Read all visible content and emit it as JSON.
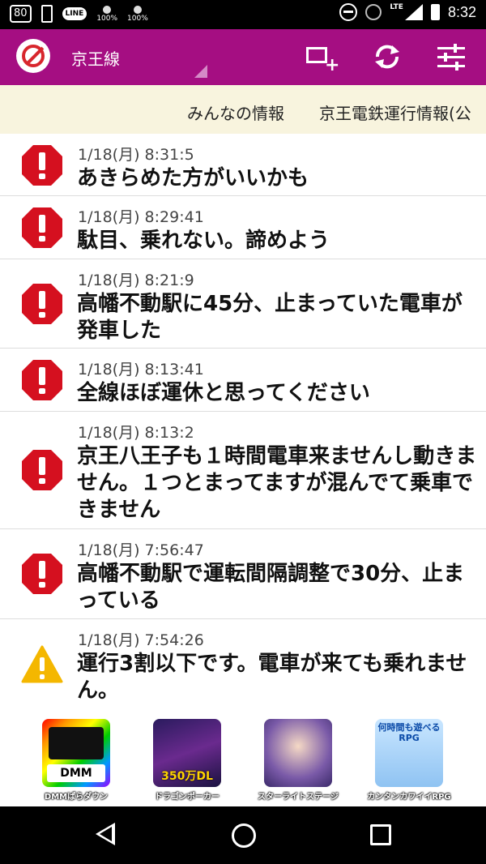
{
  "status_bar": {
    "notif_box": "80",
    "line_label": "LINE",
    "battery1": "100%",
    "battery2": "100%",
    "network": "LTE",
    "time": "8:32"
  },
  "app_bar": {
    "line_name": "京王線",
    "bg_color": "#a50e82"
  },
  "ticker": {
    "items": [
      "みんなの情報",
      "京王電鉄運行情報(公"
    ]
  },
  "posts": [
    {
      "time": "1/18(月) 8:31:5",
      "message": "あきらめた方がいいかも",
      "severity": "error"
    },
    {
      "time": "1/18(月) 8:29:41",
      "message": "駄目、乗れない。諦めよう",
      "severity": "error"
    },
    {
      "time": "1/18(月) 8:21:9",
      "message": "高幡不動駅に45分、止まっていた電車が発車した",
      "severity": "error"
    },
    {
      "time": "1/18(月) 8:13:41",
      "message": "全線ほぼ運休と思ってください",
      "severity": "error"
    },
    {
      "time": "1/18(月) 8:13:2",
      "message": "京王八王子も１時間電車来ませんし動きません。１つとまってますが混んでて乗車できません",
      "severity": "error"
    },
    {
      "time": "1/18(月) 7:56:47",
      "message": "高幡不動駅で運転間隔調整で30分、止まっている",
      "severity": "error"
    },
    {
      "time": "1/18(月) 7:54:26",
      "message": "運行3割以下です。電車が来ても乗れません。",
      "severity": "warning"
    }
  ],
  "ads": [
    {
      "caption": "DMMぱらダウン",
      "badge": "DMM"
    },
    {
      "caption": "ドラゴンポーカー",
      "badge": "350万DL"
    },
    {
      "caption": "スターライトステージ",
      "badge": ""
    },
    {
      "caption": "カンタンカワイイRPG",
      "badge": "何時間も遊べるRPG"
    }
  ],
  "colors": {
    "error": "#d5101f",
    "warning": "#f4b700",
    "ticker_bg": "#f8f4de"
  }
}
